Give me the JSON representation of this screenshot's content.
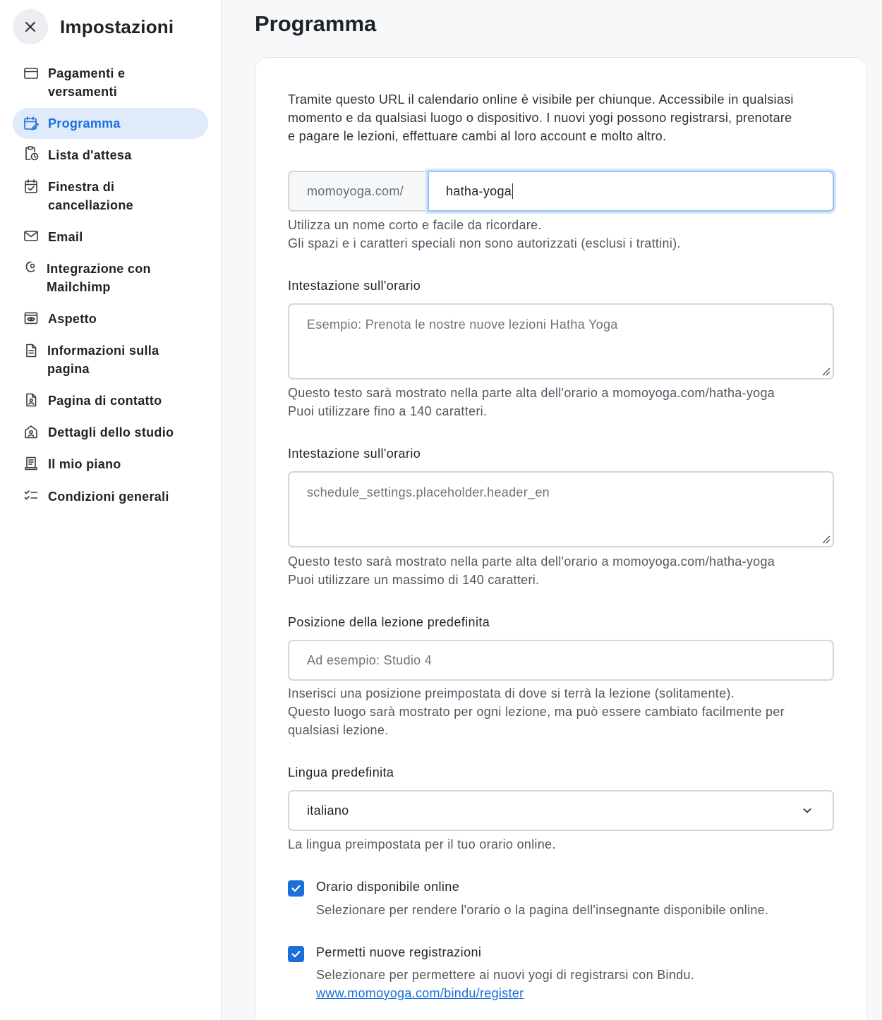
{
  "sidebar": {
    "title": "Impostazioni",
    "items": [
      {
        "lines": [
          "Pagamenti e",
          "versamenti"
        ],
        "icon": "credit-card-icon"
      },
      {
        "lines": [
          "Programma"
        ],
        "icon": "calendar-edit-icon",
        "active": true
      },
      {
        "lines": [
          "Lista d'attesa"
        ],
        "icon": "clipboard-clock-icon"
      },
      {
        "lines": [
          "Finestra di",
          "cancellazione"
        ],
        "icon": "calendar-check-icon"
      },
      {
        "lines": [
          "Email"
        ],
        "icon": "envelope-icon"
      },
      {
        "lines": [
          "Integrazione con",
          "Mailchimp"
        ],
        "icon": "mailchimp-icon"
      },
      {
        "lines": [
          "Aspetto"
        ],
        "icon": "browser-eye-icon"
      },
      {
        "lines": [
          "Informazioni sulla",
          "pagina"
        ],
        "icon": "document-icon"
      },
      {
        "lines": [
          "Pagina di contatto"
        ],
        "icon": "contact-document-icon"
      },
      {
        "lines": [
          "Dettagli dello studio"
        ],
        "icon": "studio-icon"
      },
      {
        "lines": [
          "Il mio piano"
        ],
        "icon": "receipt-icon"
      },
      {
        "lines": [
          "Condizioni generali"
        ],
        "icon": "checklist-icon"
      }
    ]
  },
  "main": {
    "title": "Programma",
    "intro": [
      "Tramite questo URL il calendario online è visibile per chiunque. Accessibile in qualsiasi",
      "momento e da qualsiasi luogo o dispositivo. I nuovi yogi possono registrarsi, prenotare",
      "e pagare le lezioni, effettuare cambi al loro account e molto altro."
    ],
    "url": {
      "prefix": "momoyoga.com/",
      "value": "hatha-yoga",
      "help": [
        "Utilizza un nome corto e facile da ricordare.",
        "Gli spazi e i caratteri speciali non sono autorizzati (esclusi i trattini)."
      ]
    },
    "header_it": {
      "label": "Intestazione sull'orario",
      "placeholder": "Esempio: Prenota le nostre nuove lezioni Hatha Yoga",
      "help": [
        "Questo testo sarà mostrato nella parte alta dell'orario a momoyoga.com/hatha-yoga",
        "Puoi utilizzare fino a 140 caratteri."
      ]
    },
    "header_en": {
      "label": "Intestazione sull'orario",
      "placeholder": "schedule_settings.placeholder.header_en",
      "help": [
        "Questo testo sarà mostrato nella parte alta dell'orario a momoyoga.com/hatha-yoga",
        "Puoi utilizzare un massimo di 140 caratteri."
      ]
    },
    "location": {
      "label": "Posizione della lezione predefinita",
      "placeholder": "Ad esempio: Studio 4",
      "help": [
        "Inserisci una posizione preimpostata di dove si terrà la lezione (solitamente).",
        "Questo luogo sarà mostrato per ogni lezione, ma può essere cambiato facilmente per",
        "qualsiasi lezione."
      ]
    },
    "language": {
      "label": "Lingua predefinita",
      "value": "italiano",
      "help": "La lingua preimpostata per il tuo orario online."
    },
    "online": {
      "label": "Orario disponibile online",
      "help": "Selezionare per rendere l'orario o la pagina dell'insegnante disponibile online.",
      "checked": true
    },
    "registrations": {
      "label": "Permetti nuove registrazioni",
      "help": "Selezionare per permettere ai nuovi yogi di registrarsi con Bindu.",
      "link": "www.momoyoga.com/bindu/register",
      "checked": true
    }
  },
  "colors": {
    "accent": "#1a6fd9",
    "active_bg": "#dfeafb"
  }
}
